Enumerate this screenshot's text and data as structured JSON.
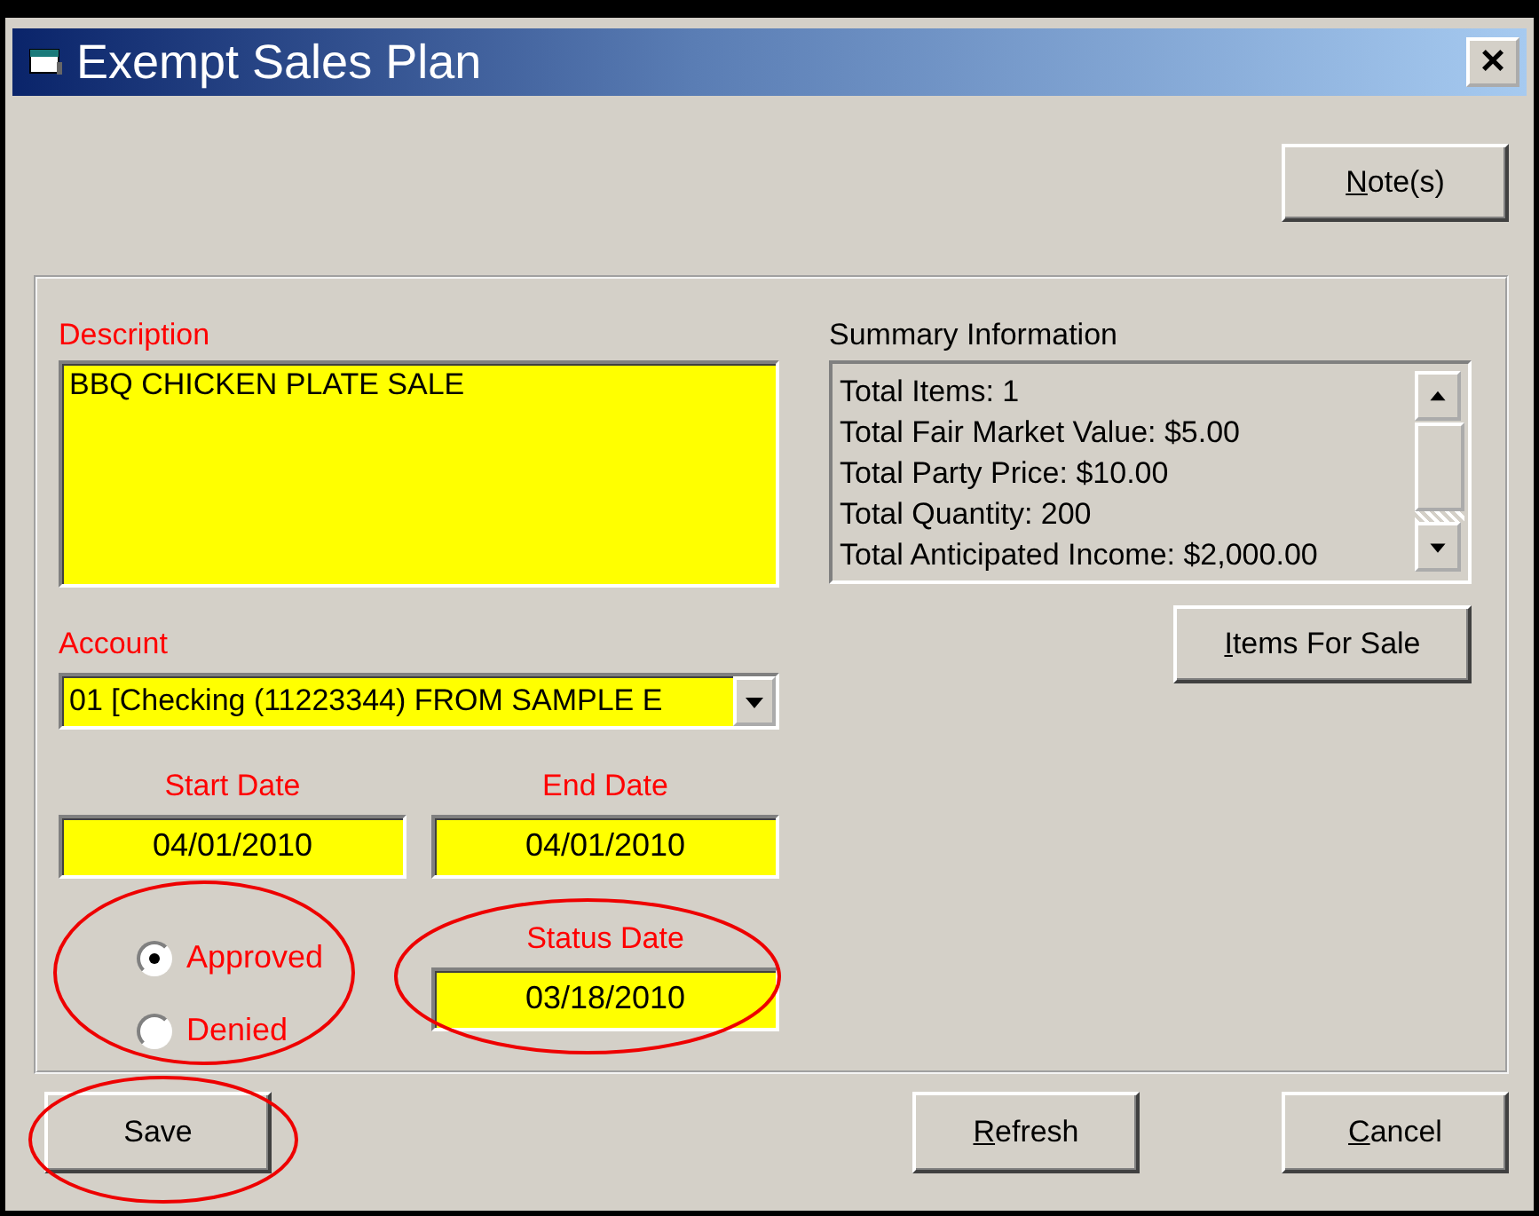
{
  "window": {
    "title": "Exempt Sales Plan",
    "close_label": "×"
  },
  "notes_button": {
    "label": "Note(s)",
    "access_key_underlined": true
  },
  "description": {
    "label": "Description",
    "value": "BBQ CHICKEN PLATE SALE"
  },
  "summary": {
    "label": "Summary Information",
    "lines": [
      "Total Items: 1",
      "Total Fair Market Value: $5.00",
      "Total Party Price: $10.00",
      "Total Quantity: 200",
      "Total Anticipated Income: $2,000.00"
    ]
  },
  "items_button": {
    "label": "Items For Sale",
    "access_key_underlined": true
  },
  "account": {
    "label": "Account",
    "value": "01 [Checking (11223344) FROM SAMPLE E"
  },
  "start_date": {
    "label": "Start Date",
    "value": "04/01/2010"
  },
  "end_date": {
    "label": "End Date",
    "value": "04/01/2010"
  },
  "status": {
    "circled": true,
    "options": [
      {
        "label": "Approved",
        "selected": true
      },
      {
        "label": "Denied",
        "selected": false
      }
    ]
  },
  "status_date": {
    "label": "Status Date",
    "value": "03/18/2010",
    "circled": true
  },
  "buttons": [
    {
      "label": "Save",
      "access_key_underlined": false,
      "circled": true
    },
    {
      "label": "Refresh",
      "access_key_underlined": true,
      "circled": false
    },
    {
      "label": "Cancel",
      "access_key_underlined": true,
      "circled": false
    }
  ]
}
